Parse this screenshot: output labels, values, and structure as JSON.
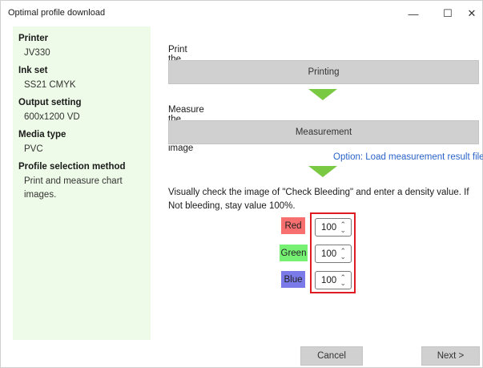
{
  "window": {
    "title": "Optimal profile download",
    "minimize_glyph": "—",
    "maximize_glyph": "☐",
    "close_glyph": "✕"
  },
  "sidebar": {
    "groups": [
      {
        "heading": "Printer",
        "value": "JV330"
      },
      {
        "heading": "Ink set",
        "value": "SS21 CMYK"
      },
      {
        "heading": "Output setting",
        "value": "600x1200 VD"
      },
      {
        "heading": "Media type",
        "value": "PVC"
      },
      {
        "heading": "Profile selection method",
        "value": "Print and measure chart images."
      }
    ]
  },
  "steps": {
    "print_label": "Print the chart image",
    "print_button": "Printing",
    "measure_label": "Measure the printed chart image",
    "measure_button": "Measurement",
    "load_link": "Option: Load measurement result file..."
  },
  "instruction": "Visually check the image of \"Check  Bleeding\" and enter a density value. If Not bleeding, stay value 100%.",
  "density": {
    "red": {
      "label": "Red",
      "value": "100",
      "color": "#f76f6f"
    },
    "green": {
      "label": "Green",
      "value": "100",
      "color": "#76f173"
    },
    "blue": {
      "label": "Blue",
      "value": "100",
      "color": "#7a7ae8"
    }
  },
  "highlight_color": "#e11b22",
  "accent_arrow_color": "#7ac943",
  "link_color": "#2a62c9",
  "footer": {
    "cancel": "Cancel",
    "next": "Next >"
  }
}
